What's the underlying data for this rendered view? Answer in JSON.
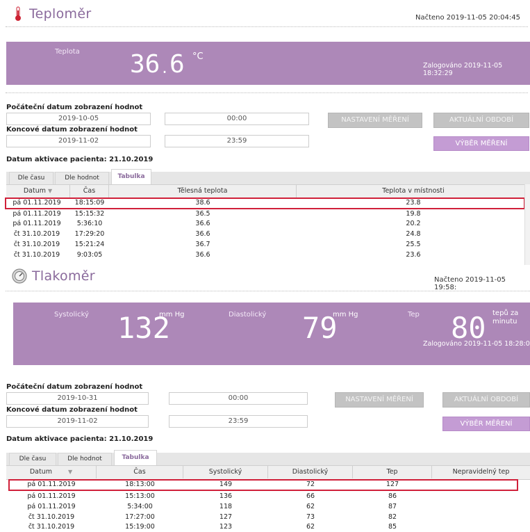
{
  "thermo": {
    "title": "Teploměr",
    "loaded": "Načteno 2019-11-05 20:04:45",
    "widget_label": "Teplota",
    "value_int": "36",
    "value_dec": "6",
    "unit": "°C",
    "logged": "Zalogováno 2019-11-05 18:32:29",
    "start_label": "Počáteční datum zobrazení hodnot",
    "start_date": "2019-10-05",
    "start_time": "00:00",
    "end_label": "Koncové datum zobrazení hodnot",
    "end_date": "2019-11-02",
    "end_time": "23:59",
    "btn_settings": "NASTAVENÍ MĚŘENÍ",
    "btn_current": "AKTUÁLNÍ OBDOBÍ",
    "btn_select": "VÝBĚR MĚŘENÍ",
    "activation": "Datum aktivace pacienta: 21.10.2019",
    "tabs": [
      "Dle času",
      "Dle hodnot",
      "Tabulka"
    ],
    "columns": [
      "Datum",
      "Čas",
      "Tělesná teplota",
      "Teplota v místnosti"
    ],
    "rows": [
      [
        "pá 01.11.2019",
        "18:15:09",
        "38.6",
        "23.8"
      ],
      [
        "pá 01.11.2019",
        "15:15:32",
        "36.5",
        "19.8"
      ],
      [
        "pá 01.11.2019",
        "5:36:10",
        "36.6",
        "20.2"
      ],
      [
        "čt 31.10.2019",
        "17:29:20",
        "36.6",
        "24.8"
      ],
      [
        "čt 31.10.2019",
        "15:21:24",
        "36.7",
        "25.5"
      ],
      [
        "čt 31.10.2019",
        "9:03:05",
        "36.6",
        "23.6"
      ]
    ]
  },
  "bp": {
    "title": "Tlakoměr",
    "loaded": "Načteno 2019-11-05 19:58:",
    "sys_label": "Systolický",
    "sys_value": "132",
    "sys_unit": "mm Hg",
    "dia_label": "Diastolický",
    "dia_value": "79",
    "dia_unit": "mm Hg",
    "pulse_label": "Tep",
    "pulse_value": "80",
    "pulse_unit_1": "tepů za",
    "pulse_unit_2": "minutu",
    "logged": "Zalogováno 2019-11-05 18:28:0",
    "start_label": "Počáteční datum zobrazení hodnot",
    "start_date": "2019-10-31",
    "start_time": "00:00",
    "end_label": "Koncové datum zobrazení hodnot",
    "end_date": "2019-11-02",
    "end_time": "23:59",
    "btn_settings": "NASTAVENÍ MĚŘENÍ",
    "btn_current": "AKTUÁLNÍ OBDOBÍ",
    "btn_select": "VÝBĚR MĚŘENÍ",
    "activation": "Datum aktivace pacienta: 21.10.2019",
    "tabs": [
      "Dle času",
      "Dle hodnot",
      "Tabulka"
    ],
    "columns": [
      "Datum",
      "Čas",
      "Systolický",
      "Diastolický",
      "Tep",
      "Nepravidelný tep"
    ],
    "rows": [
      [
        "pá 01.11.2019",
        "18:13:00",
        "149",
        "72",
        "127",
        ""
      ],
      [
        "pá 01.11.2019",
        "15:13:00",
        "136",
        "66",
        "86",
        ""
      ],
      [
        "pá 01.11.2019",
        "5:34:00",
        "118",
        "62",
        "87",
        ""
      ],
      [
        "čt 31.10.2019",
        "17:27:00",
        "127",
        "73",
        "82",
        ""
      ],
      [
        "čt 31.10.2019",
        "15:19:00",
        "123",
        "62",
        "85",
        ""
      ]
    ]
  },
  "icons": {
    "thermometer": "thermometer-icon",
    "gauge": "gauge-icon"
  },
  "colors": {
    "banner": "#ad88b8",
    "highlight": "#d0203a",
    "title": "#8a6a9c"
  }
}
